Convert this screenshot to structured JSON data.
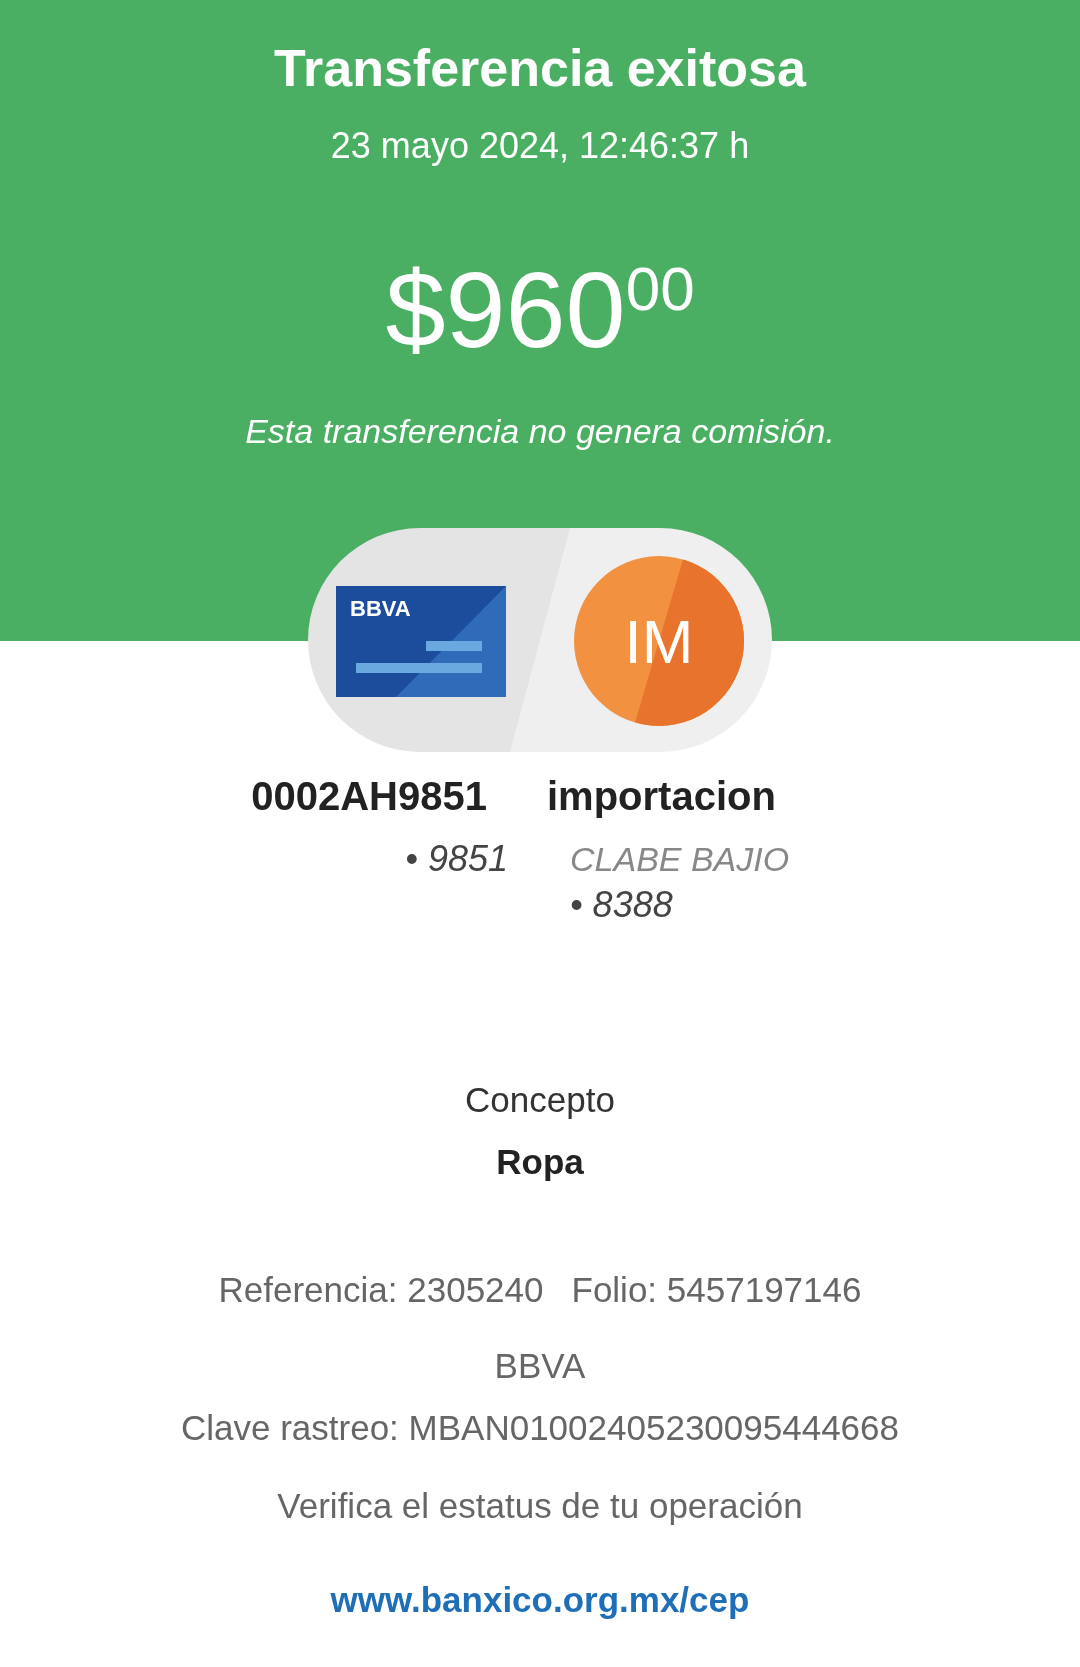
{
  "header": {
    "title": "Transferencia exitosa",
    "datetime": "23 mayo 2024, 12:46:37 h",
    "amount": {
      "currency": "$",
      "integer": "960",
      "cents": "00"
    },
    "note": "Esta transferencia no genera comisión."
  },
  "origin": {
    "logo": "BBVA",
    "name": "0002AH9851",
    "account": "• 9851"
  },
  "destination": {
    "initials": "IM",
    "name": "importacion",
    "bank": "CLABE BAJIO",
    "account": "• 8388"
  },
  "concept": {
    "label": "Concepto",
    "value": "Ropa"
  },
  "details": {
    "reference": "Referencia: 2305240",
    "folio": "Folio: 5457197146",
    "bank": "BBVA",
    "tracking": "Clave rastreo: MBAN01002405230095444668",
    "verify": "Verifica el estatus de tu operación",
    "link": "www.banxico.org.mx/cep"
  }
}
